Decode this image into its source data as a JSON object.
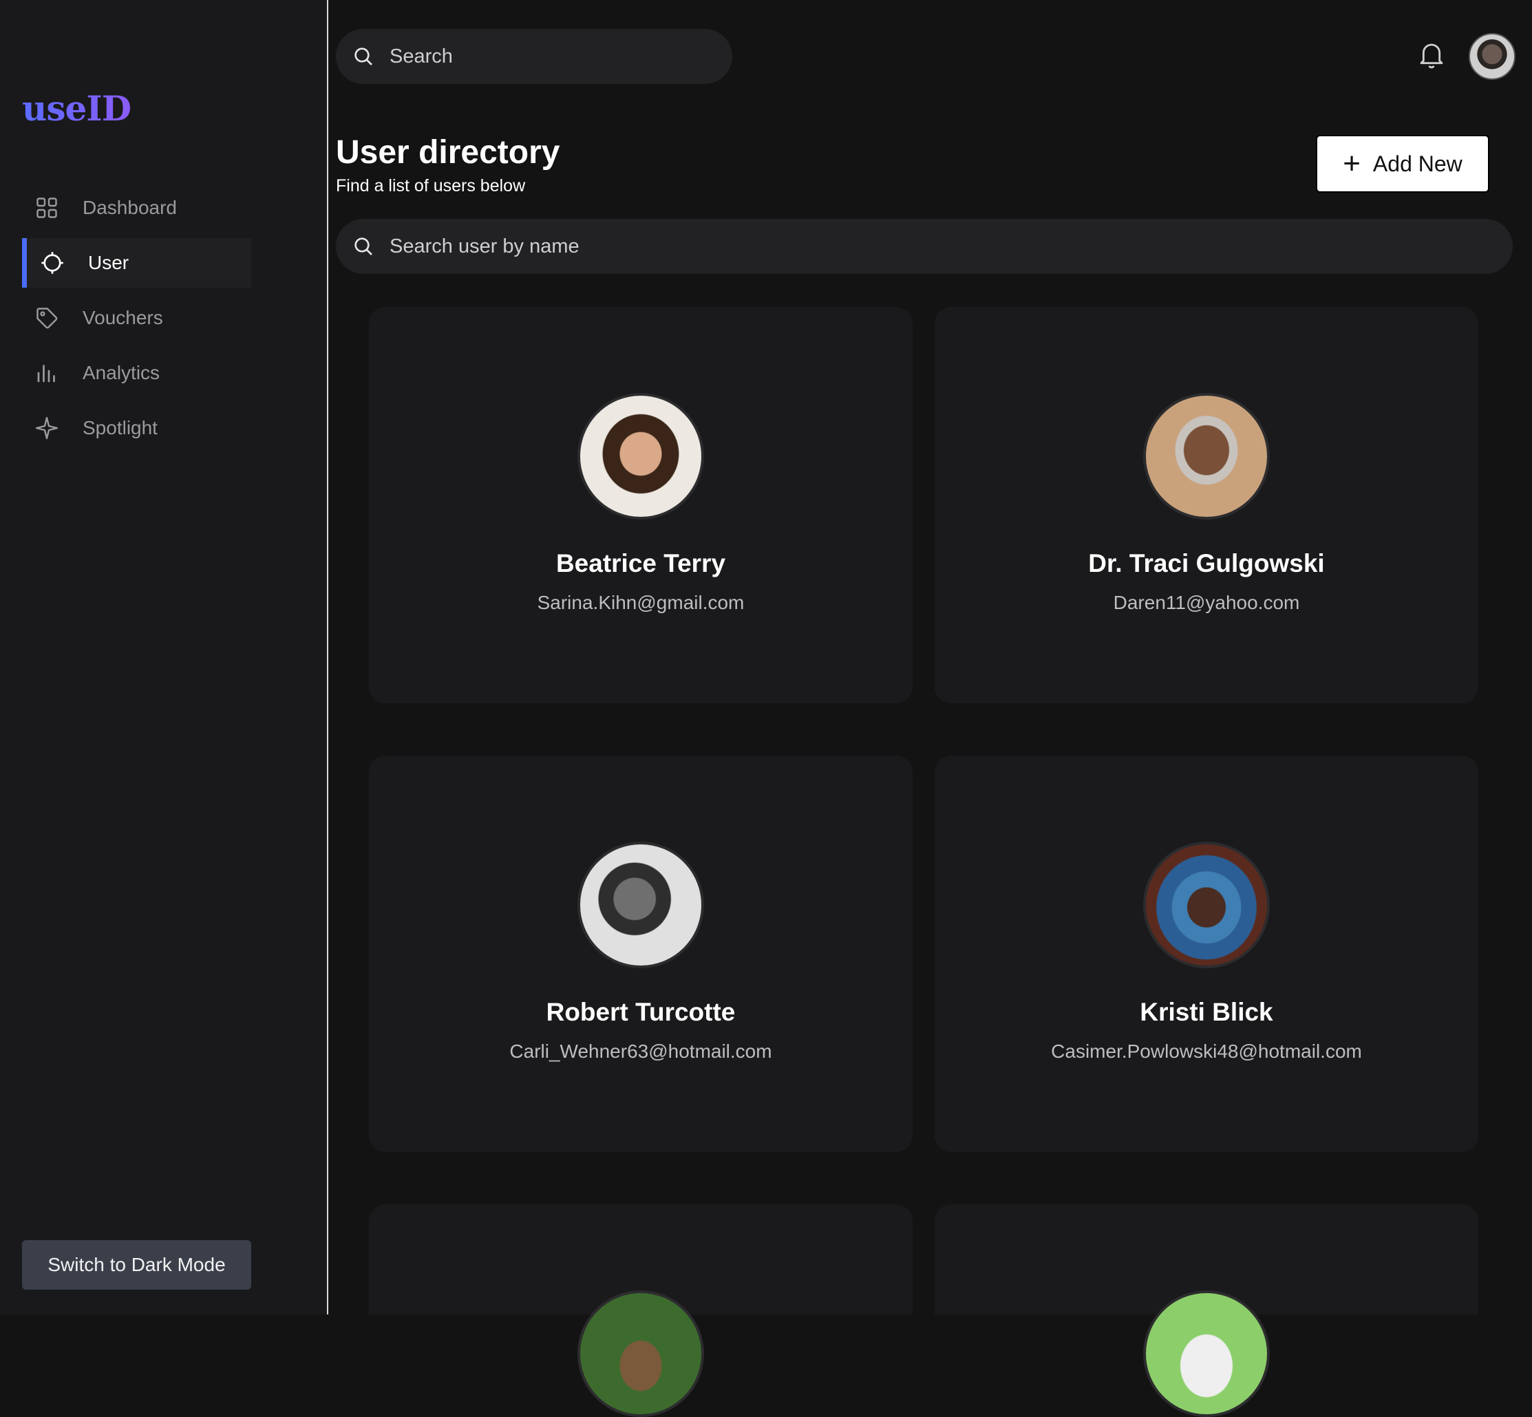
{
  "sidebar": {
    "logo": "useID",
    "items": [
      {
        "label": "Dashboard",
        "icon": "grid-icon",
        "active": false
      },
      {
        "label": "User",
        "icon": "crosshair-icon",
        "active": true
      },
      {
        "label": "Vouchers",
        "icon": "tag-icon",
        "active": false
      },
      {
        "label": "Analytics",
        "icon": "bar-chart-icon",
        "active": false
      },
      {
        "label": "Spotlight",
        "icon": "sparkle-icon",
        "active": false
      }
    ],
    "mode_button": "Switch to Dark Mode"
  },
  "header": {
    "search_placeholder": "Search"
  },
  "main": {
    "title": "User directory",
    "subtitle": "Find a list of users below",
    "add_button": "Add New",
    "user_search_placeholder": "Search user by name",
    "users": [
      {
        "name": "Beatrice Terry",
        "email": "Sarina.Kihn@gmail.com"
      },
      {
        "name": "Dr. Traci Gulgowski",
        "email": "Daren11@yahoo.com"
      },
      {
        "name": "Robert Turcotte",
        "email": "Carli_Wehner63@hotmail.com"
      },
      {
        "name": "Kristi Blick",
        "email": "Casimer.Powlowski48@hotmail.com"
      }
    ]
  },
  "colors": {
    "accent": "#4a6cf7",
    "background": "#131314",
    "card": "#1a1a1c"
  }
}
